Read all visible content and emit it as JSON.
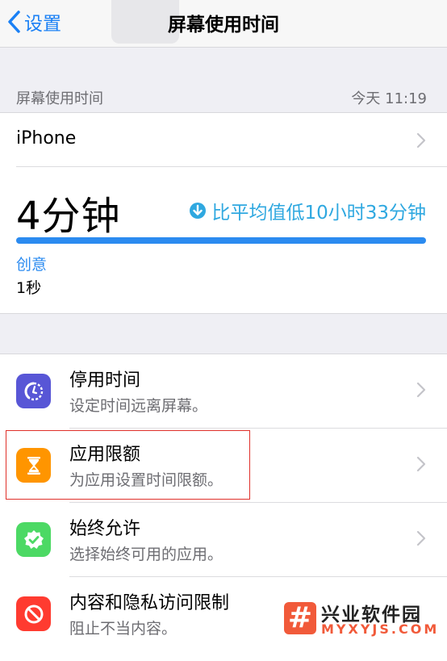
{
  "nav": {
    "back_label": "设置",
    "title": "屏幕使用时间"
  },
  "summary": {
    "section_header": "屏幕使用时间",
    "section_time": "今天 11:19",
    "device": "iPhone",
    "total": "4分钟",
    "comparison": "比平均值低10小时33分钟",
    "category_label": "创意",
    "category_value": "1秒",
    "category_fraction": 1.0
  },
  "settings": [
    {
      "title": "停用时间",
      "subtitle": "设定时间远离屏幕。",
      "icon": "downtime-icon",
      "color": "#5856d6"
    },
    {
      "title": "应用限额",
      "subtitle": "为应用设置时间限额。",
      "icon": "hourglass-icon",
      "color": "#ff9500"
    },
    {
      "title": "始终允许",
      "subtitle": "选择始终可用的应用。",
      "icon": "checkmark-badge-icon",
      "color": "#4cd964"
    },
    {
      "title": "内容和隐私访问限制",
      "subtitle": "阻止不当内容。",
      "icon": "prohibited-icon",
      "color": "#ff3b30"
    }
  ],
  "watermark": {
    "logo": "#",
    "title": "兴业软件园",
    "subtitle": "MYXYJS.COM"
  }
}
